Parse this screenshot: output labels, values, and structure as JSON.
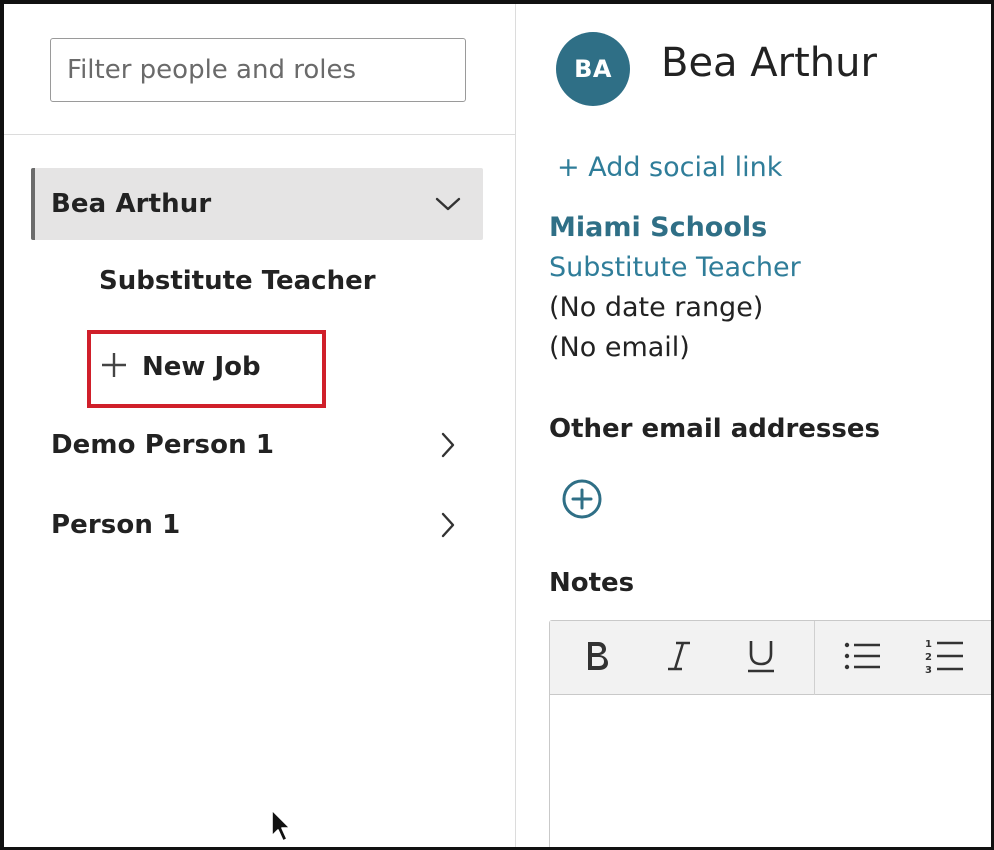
{
  "filter": {
    "placeholder": "Filter people and roles",
    "value": ""
  },
  "people": [
    {
      "name": "Bea Arthur",
      "expanded": true,
      "chevron": "chevron-down-icon"
    },
    {
      "name": "Demo Person 1",
      "expanded": false,
      "chevron": "chevron-right-icon"
    },
    {
      "name": "Person 1",
      "expanded": false,
      "chevron": "chevron-right-icon"
    }
  ],
  "roles": [
    {
      "label": "Substitute Teacher"
    }
  ],
  "new_job": {
    "icon": "plus-icon",
    "label": "New Job",
    "highlight_color": "#d01f2a"
  },
  "profile": {
    "initials": "BA",
    "name": "Bea Arthur",
    "avatar_color": "#2f6f86",
    "add_social_link": "+ Add social link",
    "organization": "Miami Schools",
    "job_title": "Substitute Teacher",
    "date_range": "(No date range)",
    "email": "(No email)"
  },
  "other_emails": {
    "heading": "Other email addresses",
    "add_icon": "add-circle-icon"
  },
  "notes": {
    "heading": "Notes",
    "toolbar": [
      {
        "name": "bold-button",
        "icon": "bold-icon"
      },
      {
        "name": "italic-button",
        "icon": "italic-icon"
      },
      {
        "name": "underline-button",
        "icon": "underline-icon"
      },
      {
        "name": "bullet-list-button",
        "icon": "bullet-list-icon"
      },
      {
        "name": "numbered-list-button",
        "icon": "numbered-list-icon"
      }
    ],
    "body": ""
  },
  "colors": {
    "link": "#2f7d99",
    "accent": "#2f6f86",
    "selected_row_bg": "#e5e4e4"
  }
}
